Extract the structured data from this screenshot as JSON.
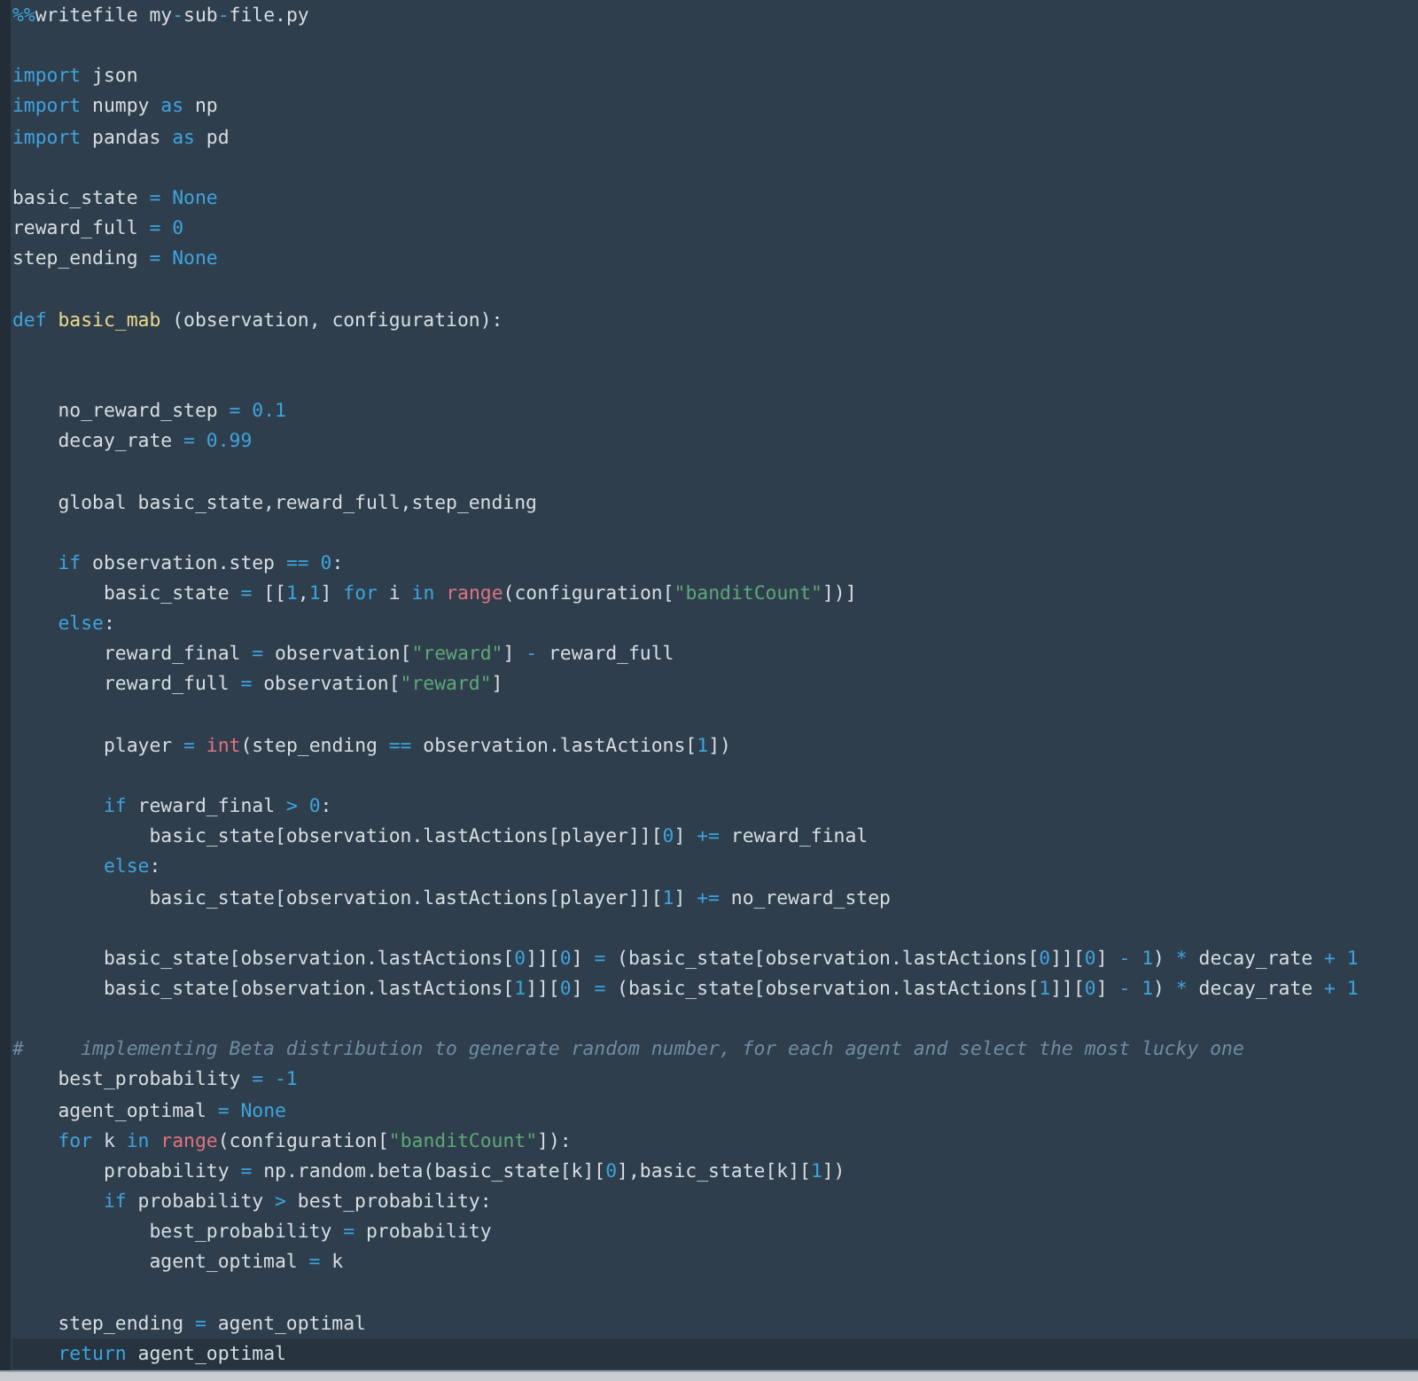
{
  "editor": {
    "lines": [
      {
        "kind": "code",
        "current": false,
        "tokens": [
          {
            "kind": "operator",
            "text": "%%"
          },
          {
            "kind": "plain",
            "text": "writefile my"
          },
          {
            "kind": "operator",
            "text": "-"
          },
          {
            "kind": "plain",
            "text": "sub"
          },
          {
            "kind": "operator",
            "text": "-"
          },
          {
            "kind": "plain",
            "text": "file.py"
          }
        ]
      },
      {
        "kind": "blank"
      },
      {
        "kind": "code",
        "current": false,
        "tokens": [
          {
            "kind": "keyword",
            "text": "import"
          },
          {
            "kind": "plain",
            "text": " json"
          }
        ]
      },
      {
        "kind": "code",
        "current": false,
        "tokens": [
          {
            "kind": "keyword",
            "text": "import"
          },
          {
            "kind": "plain",
            "text": " numpy "
          },
          {
            "kind": "keyword",
            "text": "as"
          },
          {
            "kind": "plain",
            "text": " np"
          }
        ]
      },
      {
        "kind": "code",
        "current": false,
        "tokens": [
          {
            "kind": "keyword",
            "text": "import"
          },
          {
            "kind": "plain",
            "text": " pandas "
          },
          {
            "kind": "keyword",
            "text": "as"
          },
          {
            "kind": "plain",
            "text": " pd"
          }
        ]
      },
      {
        "kind": "blank"
      },
      {
        "kind": "code",
        "current": false,
        "tokens": [
          {
            "kind": "plain",
            "text": "basic_state "
          },
          {
            "kind": "operator",
            "text": "= "
          },
          {
            "kind": "keyword",
            "text": "None"
          }
        ]
      },
      {
        "kind": "code",
        "current": false,
        "tokens": [
          {
            "kind": "plain",
            "text": "reward_full "
          },
          {
            "kind": "operator",
            "text": "= "
          },
          {
            "kind": "number",
            "text": "0"
          }
        ]
      },
      {
        "kind": "code",
        "current": false,
        "tokens": [
          {
            "kind": "plain",
            "text": "step_ending "
          },
          {
            "kind": "operator",
            "text": "= "
          },
          {
            "kind": "keyword",
            "text": "None"
          }
        ]
      },
      {
        "kind": "blank"
      },
      {
        "kind": "code",
        "current": false,
        "tokens": [
          {
            "kind": "keyword",
            "text": "def "
          },
          {
            "kind": "function",
            "text": "basic_mab"
          },
          {
            "kind": "plain",
            "text": " (observation, configuration):"
          }
        ]
      },
      {
        "kind": "blank"
      },
      {
        "kind": "blank"
      },
      {
        "kind": "code",
        "current": false,
        "tokens": [
          {
            "kind": "plain",
            "text": "    no_reward_step "
          },
          {
            "kind": "operator",
            "text": "= "
          },
          {
            "kind": "number",
            "text": "0.1"
          }
        ]
      },
      {
        "kind": "code",
        "current": false,
        "tokens": [
          {
            "kind": "plain",
            "text": "    decay_rate "
          },
          {
            "kind": "operator",
            "text": "= "
          },
          {
            "kind": "number",
            "text": "0.99"
          }
        ]
      },
      {
        "kind": "blank"
      },
      {
        "kind": "code",
        "current": false,
        "tokens": [
          {
            "kind": "plain",
            "text": "    global basic_state,reward_full,step_ending"
          }
        ]
      },
      {
        "kind": "blank"
      },
      {
        "kind": "code",
        "current": false,
        "tokens": [
          {
            "kind": "keyword",
            "text": "    if"
          },
          {
            "kind": "plain",
            "text": " observation.step "
          },
          {
            "kind": "operator",
            "text": "== "
          },
          {
            "kind": "number",
            "text": "0"
          },
          {
            "kind": "plain",
            "text": ":"
          }
        ]
      },
      {
        "kind": "code",
        "current": false,
        "tokens": [
          {
            "kind": "plain",
            "text": "        basic_state "
          },
          {
            "kind": "operator",
            "text": "="
          },
          {
            "kind": "plain",
            "text": " [["
          },
          {
            "kind": "number",
            "text": "1"
          },
          {
            "kind": "plain",
            "text": ","
          },
          {
            "kind": "number",
            "text": "1"
          },
          {
            "kind": "plain",
            "text": "] "
          },
          {
            "kind": "keyword",
            "text": "for"
          },
          {
            "kind": "plain",
            "text": " i "
          },
          {
            "kind": "keyword",
            "text": "in "
          },
          {
            "kind": "builtin",
            "text": "range"
          },
          {
            "kind": "plain",
            "text": "(configuration["
          },
          {
            "kind": "string",
            "text": "\"banditCount\""
          },
          {
            "kind": "plain",
            "text": "])]"
          }
        ]
      },
      {
        "kind": "code",
        "current": false,
        "tokens": [
          {
            "kind": "keyword",
            "text": "    else"
          },
          {
            "kind": "plain",
            "text": ":"
          }
        ]
      },
      {
        "kind": "code",
        "current": false,
        "tokens": [
          {
            "kind": "plain",
            "text": "        reward_final "
          },
          {
            "kind": "operator",
            "text": "="
          },
          {
            "kind": "plain",
            "text": " observation["
          },
          {
            "kind": "string",
            "text": "\"reward\""
          },
          {
            "kind": "plain",
            "text": "] "
          },
          {
            "kind": "operator",
            "text": "-"
          },
          {
            "kind": "plain",
            "text": " reward_full"
          }
        ]
      },
      {
        "kind": "code",
        "current": false,
        "tokens": [
          {
            "kind": "plain",
            "text": "        reward_full "
          },
          {
            "kind": "operator",
            "text": "="
          },
          {
            "kind": "plain",
            "text": " observation["
          },
          {
            "kind": "string",
            "text": "\"reward\""
          },
          {
            "kind": "plain",
            "text": "]"
          }
        ]
      },
      {
        "kind": "blank"
      },
      {
        "kind": "code",
        "current": false,
        "tokens": [
          {
            "kind": "plain",
            "text": "        player "
          },
          {
            "kind": "operator",
            "text": "= "
          },
          {
            "kind": "builtin",
            "text": "int"
          },
          {
            "kind": "plain",
            "text": "(step_ending "
          },
          {
            "kind": "operator",
            "text": "=="
          },
          {
            "kind": "plain",
            "text": " observation.lastActions["
          },
          {
            "kind": "number",
            "text": "1"
          },
          {
            "kind": "plain",
            "text": "])"
          }
        ]
      },
      {
        "kind": "blank"
      },
      {
        "kind": "code",
        "current": false,
        "tokens": [
          {
            "kind": "keyword",
            "text": "        if"
          },
          {
            "kind": "plain",
            "text": " reward_final "
          },
          {
            "kind": "operator",
            "text": "> "
          },
          {
            "kind": "number",
            "text": "0"
          },
          {
            "kind": "plain",
            "text": ":"
          }
        ]
      },
      {
        "kind": "code",
        "current": false,
        "tokens": [
          {
            "kind": "plain",
            "text": "            basic_state[observation.lastActions[player]]["
          },
          {
            "kind": "number",
            "text": "0"
          },
          {
            "kind": "plain",
            "text": "] "
          },
          {
            "kind": "operator",
            "text": "+="
          },
          {
            "kind": "plain",
            "text": " reward_final"
          }
        ]
      },
      {
        "kind": "code",
        "current": false,
        "tokens": [
          {
            "kind": "keyword",
            "text": "        else"
          },
          {
            "kind": "plain",
            "text": ":"
          }
        ]
      },
      {
        "kind": "code",
        "current": false,
        "tokens": [
          {
            "kind": "plain",
            "text": "            basic_state[observation.lastActions[player]]["
          },
          {
            "kind": "number",
            "text": "1"
          },
          {
            "kind": "plain",
            "text": "] "
          },
          {
            "kind": "operator",
            "text": "+="
          },
          {
            "kind": "plain",
            "text": " no_reward_step"
          }
        ]
      },
      {
        "kind": "blank"
      },
      {
        "kind": "code",
        "current": false,
        "tokens": [
          {
            "kind": "plain",
            "text": "        basic_state[observation.lastActions["
          },
          {
            "kind": "number",
            "text": "0"
          },
          {
            "kind": "plain",
            "text": "]]["
          },
          {
            "kind": "number",
            "text": "0"
          },
          {
            "kind": "plain",
            "text": "] "
          },
          {
            "kind": "operator",
            "text": "="
          },
          {
            "kind": "plain",
            "text": " (basic_state[observation.lastActions["
          },
          {
            "kind": "number",
            "text": "0"
          },
          {
            "kind": "plain",
            "text": "]]["
          },
          {
            "kind": "number",
            "text": "0"
          },
          {
            "kind": "plain",
            "text": "] "
          },
          {
            "kind": "operator",
            "text": "- "
          },
          {
            "kind": "number",
            "text": "1"
          },
          {
            "kind": "plain",
            "text": ") "
          },
          {
            "kind": "operator",
            "text": "*"
          },
          {
            "kind": "plain",
            "text": " decay_rate "
          },
          {
            "kind": "operator",
            "text": "+ "
          },
          {
            "kind": "number",
            "text": "1"
          }
        ]
      },
      {
        "kind": "code",
        "current": false,
        "tokens": [
          {
            "kind": "plain",
            "text": "        basic_state[observation.lastActions["
          },
          {
            "kind": "number",
            "text": "1"
          },
          {
            "kind": "plain",
            "text": "]]["
          },
          {
            "kind": "number",
            "text": "0"
          },
          {
            "kind": "plain",
            "text": "] "
          },
          {
            "kind": "operator",
            "text": "="
          },
          {
            "kind": "plain",
            "text": " (basic_state[observation.lastActions["
          },
          {
            "kind": "number",
            "text": "1"
          },
          {
            "kind": "plain",
            "text": "]]["
          },
          {
            "kind": "number",
            "text": "0"
          },
          {
            "kind": "plain",
            "text": "] "
          },
          {
            "kind": "operator",
            "text": "- "
          },
          {
            "kind": "number",
            "text": "1"
          },
          {
            "kind": "plain",
            "text": ") "
          },
          {
            "kind": "operator",
            "text": "*"
          },
          {
            "kind": "plain",
            "text": " decay_rate "
          },
          {
            "kind": "operator",
            "text": "+ "
          },
          {
            "kind": "number",
            "text": "1"
          }
        ]
      },
      {
        "kind": "blank"
      },
      {
        "kind": "code",
        "current": false,
        "tokens": [
          {
            "kind": "comment",
            "text": "#     implementing Beta distribution to generate random number, for each agent and select the most lucky one"
          }
        ]
      },
      {
        "kind": "code",
        "current": false,
        "tokens": [
          {
            "kind": "plain",
            "text": "    best_probability "
          },
          {
            "kind": "operator",
            "text": "= "
          },
          {
            "kind": "number",
            "text": "-1"
          }
        ]
      },
      {
        "kind": "code",
        "current": false,
        "tokens": [
          {
            "kind": "plain",
            "text": "    agent_optimal "
          },
          {
            "kind": "operator",
            "text": "= "
          },
          {
            "kind": "keyword",
            "text": "None"
          }
        ]
      },
      {
        "kind": "code",
        "current": false,
        "tokens": [
          {
            "kind": "keyword",
            "text": "    for"
          },
          {
            "kind": "plain",
            "text": " k "
          },
          {
            "kind": "keyword",
            "text": "in "
          },
          {
            "kind": "builtin",
            "text": "range"
          },
          {
            "kind": "plain",
            "text": "(configuration["
          },
          {
            "kind": "string",
            "text": "\"banditCount\""
          },
          {
            "kind": "plain",
            "text": "]):"
          }
        ]
      },
      {
        "kind": "code",
        "current": false,
        "tokens": [
          {
            "kind": "plain",
            "text": "        probability "
          },
          {
            "kind": "operator",
            "text": "="
          },
          {
            "kind": "plain",
            "text": " np.random.beta(basic_state[k]["
          },
          {
            "kind": "number",
            "text": "0"
          },
          {
            "kind": "plain",
            "text": "],basic_state[k]["
          },
          {
            "kind": "number",
            "text": "1"
          },
          {
            "kind": "plain",
            "text": "])"
          }
        ]
      },
      {
        "kind": "code",
        "current": false,
        "tokens": [
          {
            "kind": "keyword",
            "text": "        if"
          },
          {
            "kind": "plain",
            "text": " probability "
          },
          {
            "kind": "operator",
            "text": ">"
          },
          {
            "kind": "plain",
            "text": " best_probability:"
          }
        ]
      },
      {
        "kind": "code",
        "current": false,
        "tokens": [
          {
            "kind": "plain",
            "text": "            best_probability "
          },
          {
            "kind": "operator",
            "text": "="
          },
          {
            "kind": "plain",
            "text": " probability"
          }
        ]
      },
      {
        "kind": "code",
        "current": false,
        "tokens": [
          {
            "kind": "plain",
            "text": "            agent_optimal "
          },
          {
            "kind": "operator",
            "text": "="
          },
          {
            "kind": "plain",
            "text": " k"
          }
        ]
      },
      {
        "kind": "blank"
      },
      {
        "kind": "code",
        "current": false,
        "tokens": [
          {
            "kind": "plain",
            "text": "    step_ending "
          },
          {
            "kind": "operator",
            "text": "="
          },
          {
            "kind": "plain",
            "text": " agent_optimal"
          }
        ]
      },
      {
        "kind": "code",
        "current": true,
        "tokens": [
          {
            "kind": "keyword",
            "text": "    return"
          },
          {
            "kind": "plain",
            "text": " agent_optimal"
          }
        ]
      }
    ]
  }
}
